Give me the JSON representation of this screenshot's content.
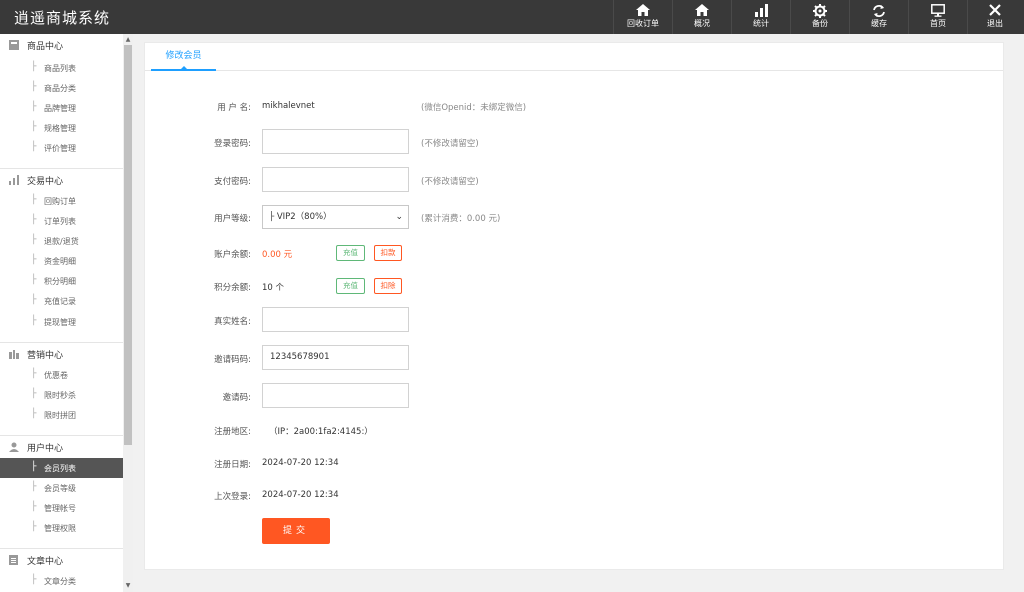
{
  "app": {
    "title": "逍遥商城系统"
  },
  "topnav": [
    {
      "label": "回收订单",
      "icon": "home-icon"
    },
    {
      "label": "概况",
      "icon": "home-icon"
    },
    {
      "label": "统计",
      "icon": "bar-chart-icon"
    },
    {
      "label": "备份",
      "icon": "gear-icon"
    },
    {
      "label": "缓存",
      "icon": "refresh-icon"
    },
    {
      "label": "首页",
      "icon": "monitor-icon"
    },
    {
      "label": "退出",
      "icon": "close-icon"
    }
  ],
  "sidebar": {
    "groups": [
      {
        "label": "商品中心",
        "icon": "goods-icon",
        "items": [
          "商品列表",
          "商品分类",
          "品牌管理",
          "规格管理",
          "评价管理"
        ]
      },
      {
        "label": "交易中心",
        "icon": "bar-chart-icon",
        "items": [
          "回购订单",
          "订单列表",
          "退款/退货",
          "资金明细",
          "积分明细",
          "充值记录",
          "提现管理"
        ]
      },
      {
        "label": "营销中心",
        "icon": "marketing-icon",
        "items": [
          "优惠卷",
          "限时秒杀",
          "限时拼团"
        ]
      },
      {
        "label": "用户中心",
        "icon": "user-icon",
        "items": [
          "会员列表",
          "会员等级",
          "管理帐号",
          "管理权限"
        ]
      },
      {
        "label": "文章中心",
        "icon": "document-icon",
        "items": [
          "文章分类"
        ]
      }
    ],
    "active_item": "会员列表"
  },
  "tabs": [
    {
      "label": "修改会员"
    }
  ],
  "form": {
    "username_label": "用 户 名:",
    "username_value": "mikhalevnet",
    "username_hint": "(微信Openid：未绑定微信)",
    "login_pwd_label": "登录密码:",
    "login_pwd_hint": "(不修改请留空)",
    "pay_pwd_label": "支付密码:",
    "pay_pwd_hint": "(不修改请留空)",
    "level_label": "用户等级:",
    "level_value": "├ VIP2（80%）",
    "level_hint": "(累计消费：0.00 元)",
    "balance_label": "账户余额:",
    "balance_value": "0.00 元",
    "balance_recharge": "充值",
    "balance_deduct": "扣款",
    "points_label": "积分余额:",
    "points_value": "10 个",
    "points_recharge": "充值",
    "points_deduct": "扣除",
    "realname_label": "真实姓名:",
    "realname_value": "",
    "invite_code_label": "邀请码码:",
    "invite_code_value": "12345678901",
    "inviter_label": "邀请码:",
    "inviter_value": "",
    "region_label": "注册地区:",
    "region_value": "（IP：2a00:1fa2:4145:）",
    "reg_date_label": "注册日期:",
    "reg_date_value": "2024-07-20 12:34",
    "last_login_label": "上次登录:",
    "last_login_value": "2024-07-20 12:34",
    "submit_label": "提交"
  },
  "colors": {
    "accent": "#1e9fff",
    "primary_button": "#ff5722",
    "green": "#5fb878",
    "topbar": "#393939",
    "balance": "#ff5722"
  }
}
